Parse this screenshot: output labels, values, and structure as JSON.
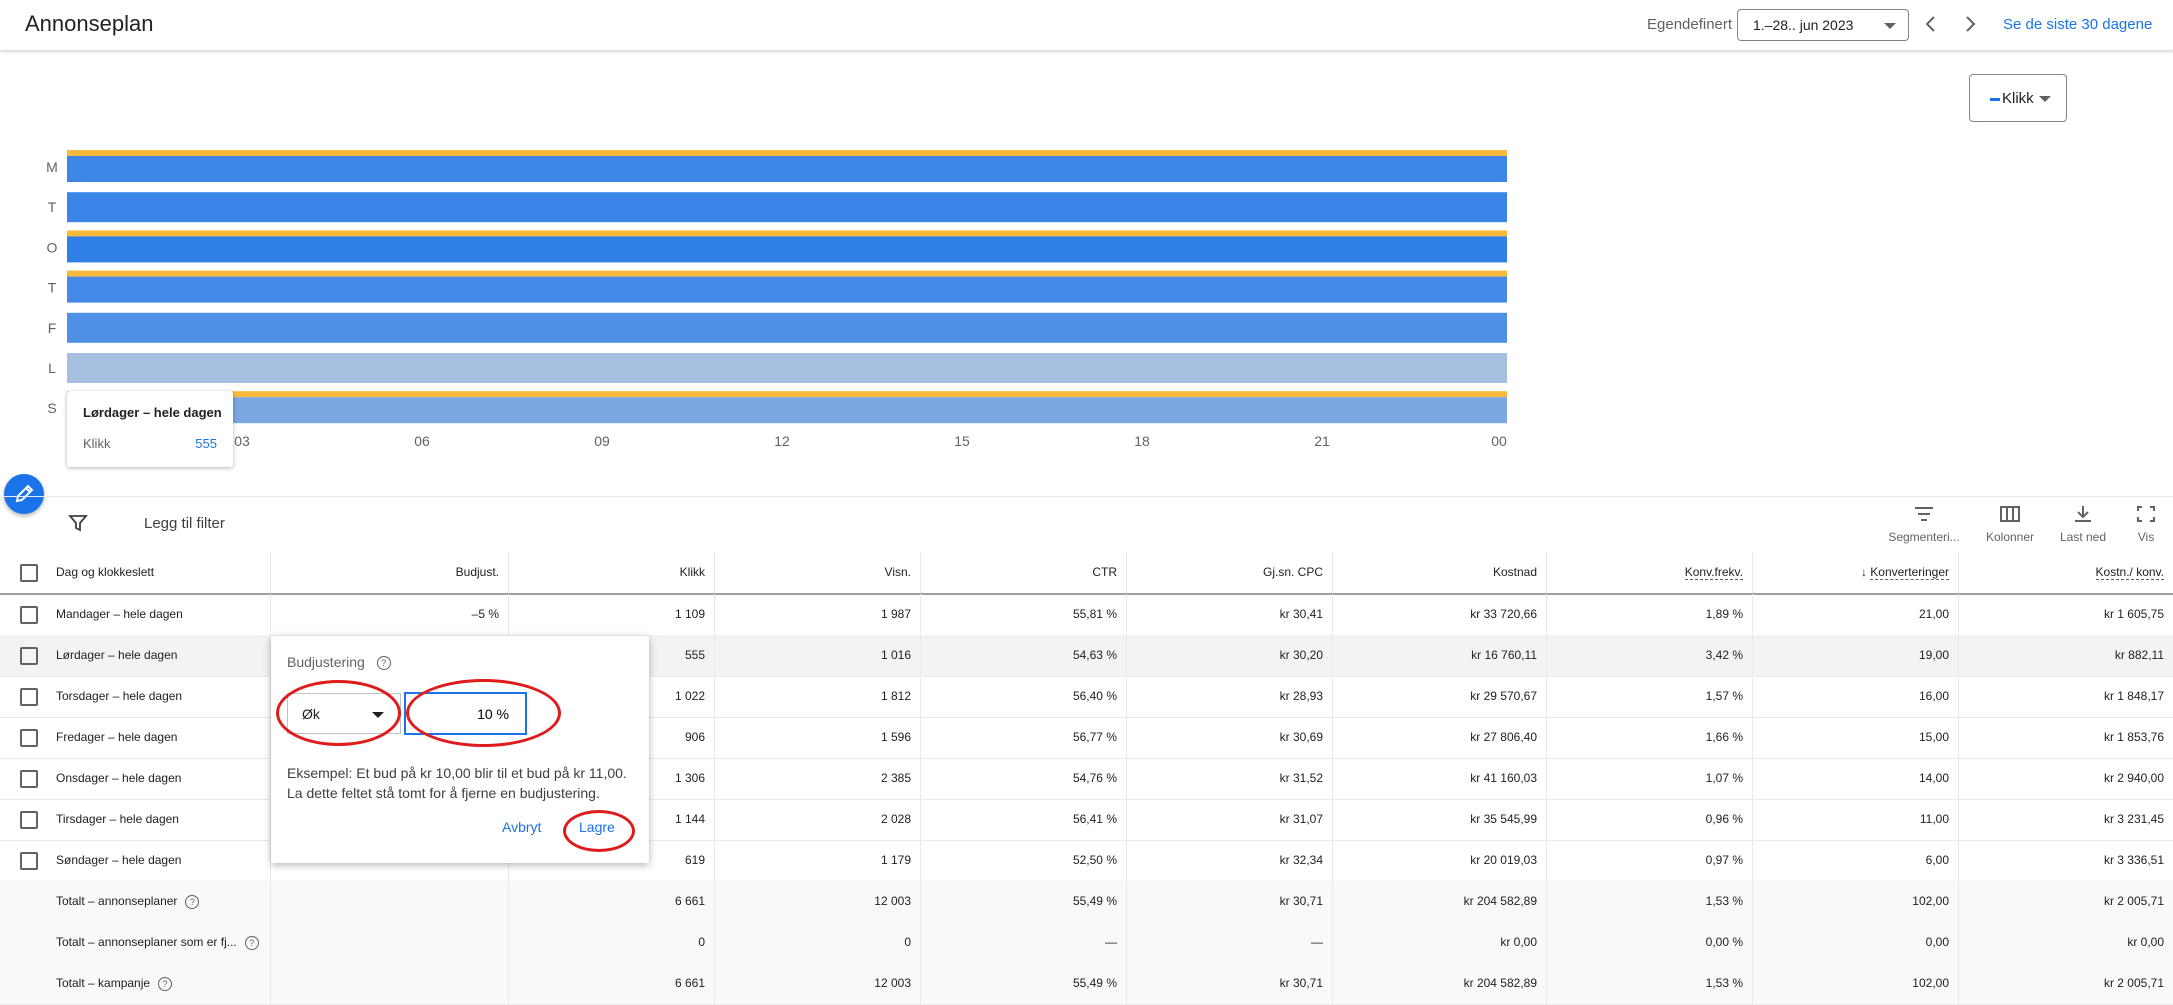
{
  "header": {
    "title": "Annonseplan",
    "range_label": "Egendefinert",
    "date_range": "1.–28.. jun 2023",
    "last_30": "Se de siste 30 dagene"
  },
  "chart": {
    "metric_dropdown": "Klikk",
    "tooltip": {
      "title": "Lørdager – hele dagen",
      "metric": "Klikk",
      "value": "555"
    }
  },
  "chart_data": {
    "type": "heatmap",
    "y_categories": [
      "M",
      "T",
      "O",
      "T",
      "F",
      "L",
      "S"
    ],
    "x_ticks": [
      "03",
      "06",
      "09",
      "12",
      "15",
      "18",
      "21",
      "00"
    ],
    "metric": "Klikk",
    "values": [
      1109,
      1144,
      1306,
      1022,
      906,
      555,
      619
    ],
    "bid_adjustment_marker": [
      true,
      false,
      true,
      true,
      false,
      false,
      true
    ],
    "colors": {
      "bar_dark": "#2f7fe8",
      "bar_light": "#a7bfdf",
      "marker": "#f6b93b"
    }
  },
  "toolbar": {
    "add_filter": "Legg til filter",
    "segment": "Segmenteri...",
    "columns": "Kolonner",
    "download": "Last ned",
    "view": "Vis"
  },
  "table": {
    "headers": [
      "Dag og klokkeslett",
      "Budjust.",
      "Klikk",
      "Visn.",
      "CTR",
      "Gj.sn. CPC",
      "Kostnad",
      "Konv.frekv.",
      "Konverteringer",
      "Kostn./ konv."
    ],
    "rows": [
      [
        "Mandager – hele dagen",
        "–5 %",
        "1 109",
        "1 987",
        "55,81 %",
        "kr 30,41",
        "kr 33 720,66",
        "1,89 %",
        "21,00",
        "kr 1 605,75"
      ],
      [
        "Lørdager – hele dagen",
        "",
        "555",
        "1 016",
        "54,63 %",
        "kr 30,20",
        "kr 16 760,11",
        "3,42 %",
        "19,00",
        "kr 882,11"
      ],
      [
        "Torsdager – hele dagen",
        "",
        "1 022",
        "1 812",
        "56,40 %",
        "kr 28,93",
        "kr 29 570,67",
        "1,57 %",
        "16,00",
        "kr 1 848,17"
      ],
      [
        "Fredager – hele dagen",
        "",
        "906",
        "1 596",
        "56,77 %",
        "kr 30,69",
        "kr 27 806,40",
        "1,66 %",
        "15,00",
        "kr 1 853,76"
      ],
      [
        "Onsdager – hele dagen",
        "",
        "1 306",
        "2 385",
        "54,76 %",
        "kr 31,52",
        "kr 41 160,03",
        "1,07 %",
        "14,00",
        "kr 2 940,00"
      ],
      [
        "Tirsdager – hele dagen",
        "",
        "1 144",
        "2 028",
        "56,41 %",
        "kr 31,07",
        "kr 35 545,99",
        "0,96 %",
        "11,00",
        "kr 3 231,45"
      ],
      [
        "Søndager – hele dagen",
        "",
        "619",
        "1 179",
        "52,50 %",
        "kr 32,34",
        "kr 20 019,03",
        "0,97 %",
        "6,00",
        "kr 3 336,51"
      ]
    ],
    "totals": [
      [
        "Totalt – annonseplaner",
        "",
        "6 661",
        "12 003",
        "55,49 %",
        "kr 30,71",
        "kr 204 582,89",
        "1,53 %",
        "102,00",
        "kr 2 005,71"
      ],
      [
        "Totalt – annonseplaner som er fj...",
        "",
        "0",
        "0",
        "—",
        "—",
        "kr 0,00",
        "0,00 %",
        "0,00",
        "kr 0,00"
      ],
      [
        "Totalt – kampanje",
        "",
        "6 661",
        "12 003",
        "55,49 %",
        "kr 30,71",
        "kr 204 582,89",
        "1,53 %",
        "102,00",
        "kr 2 005,71"
      ]
    ]
  },
  "popup": {
    "title": "Budjustering",
    "direction": "Øk",
    "value": "10 %",
    "example_line1": "Eksempel: Et bud på kr 10,00 blir til et bud på kr 11,00.",
    "example_line2": "La dette feltet stå tomt for å fjerne en budjustering.",
    "cancel": "Avbryt",
    "save": "Lagre"
  },
  "colors": {
    "accent": "#1a73e8",
    "annotation": "#e01b1b"
  }
}
